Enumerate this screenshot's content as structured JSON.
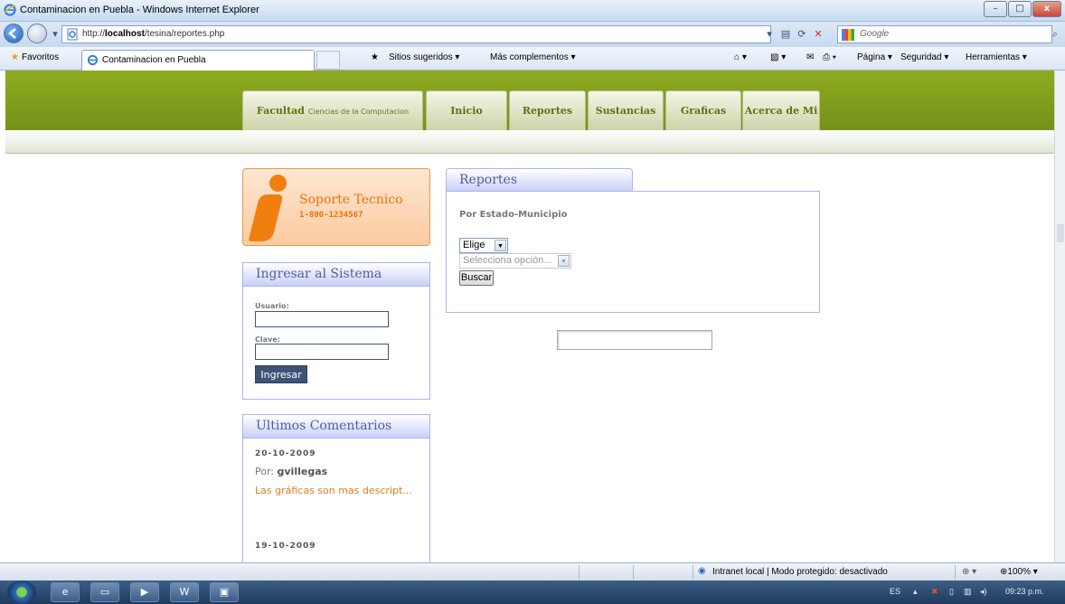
{
  "window": {
    "title": "Contaminacion en Puebla - Windows Internet Explorer",
    "controls": {
      "minimize": "–",
      "maximize": "□",
      "close": "x"
    }
  },
  "addressbar": {
    "url_prefix": "http://",
    "url_host": "localhost",
    "url_path": "/tesina/reportes.php",
    "search_placeholder": "Google"
  },
  "favorites_bar": {
    "favorites_label": "Favoritos",
    "tab_title": "Contaminacion en Puebla",
    "sitios_sugeridos": "Sitios sugeridos ▾",
    "mas_complementos": "Más complementos ▾",
    "pagina": "Página ▾",
    "seguridad": "Seguridad ▾",
    "herramientas": "Herramientas ▾"
  },
  "site_nav": {
    "facultad": "Facultad",
    "facultad_sub": "Ciencias de la Computacion",
    "items": [
      "Inicio",
      "Reportes",
      "Sustancias",
      "Graficas",
      "Acerca de Mi"
    ]
  },
  "soporte": {
    "title": "Soporte Tecnico",
    "phone": "1-800-1234567"
  },
  "login": {
    "title": "Ingresar al Sistema",
    "usuario_label": "Usuario:",
    "clave_label": "Clave:",
    "button": "Ingresar"
  },
  "comments": {
    "title": "Ultimos Comentarios",
    "items": [
      {
        "date": "20-10-2009",
        "por": "Por:",
        "author": "gvillegas",
        "text": "Las gráficas son mas descript..."
      },
      {
        "date": "19-10-2009"
      }
    ]
  },
  "reportes": {
    "title": "Reportes",
    "subtitle": "Por Estado-Municipio",
    "select_estado": "Elige",
    "select_municipio": "Selecciona opción...",
    "buscar": "Buscar"
  },
  "statusbar": {
    "zone": "Intranet local | Modo protegido: desactivado",
    "zoom": "100%"
  },
  "taskbar": {
    "lang": "ES",
    "clock": "09:23 p.m."
  }
}
